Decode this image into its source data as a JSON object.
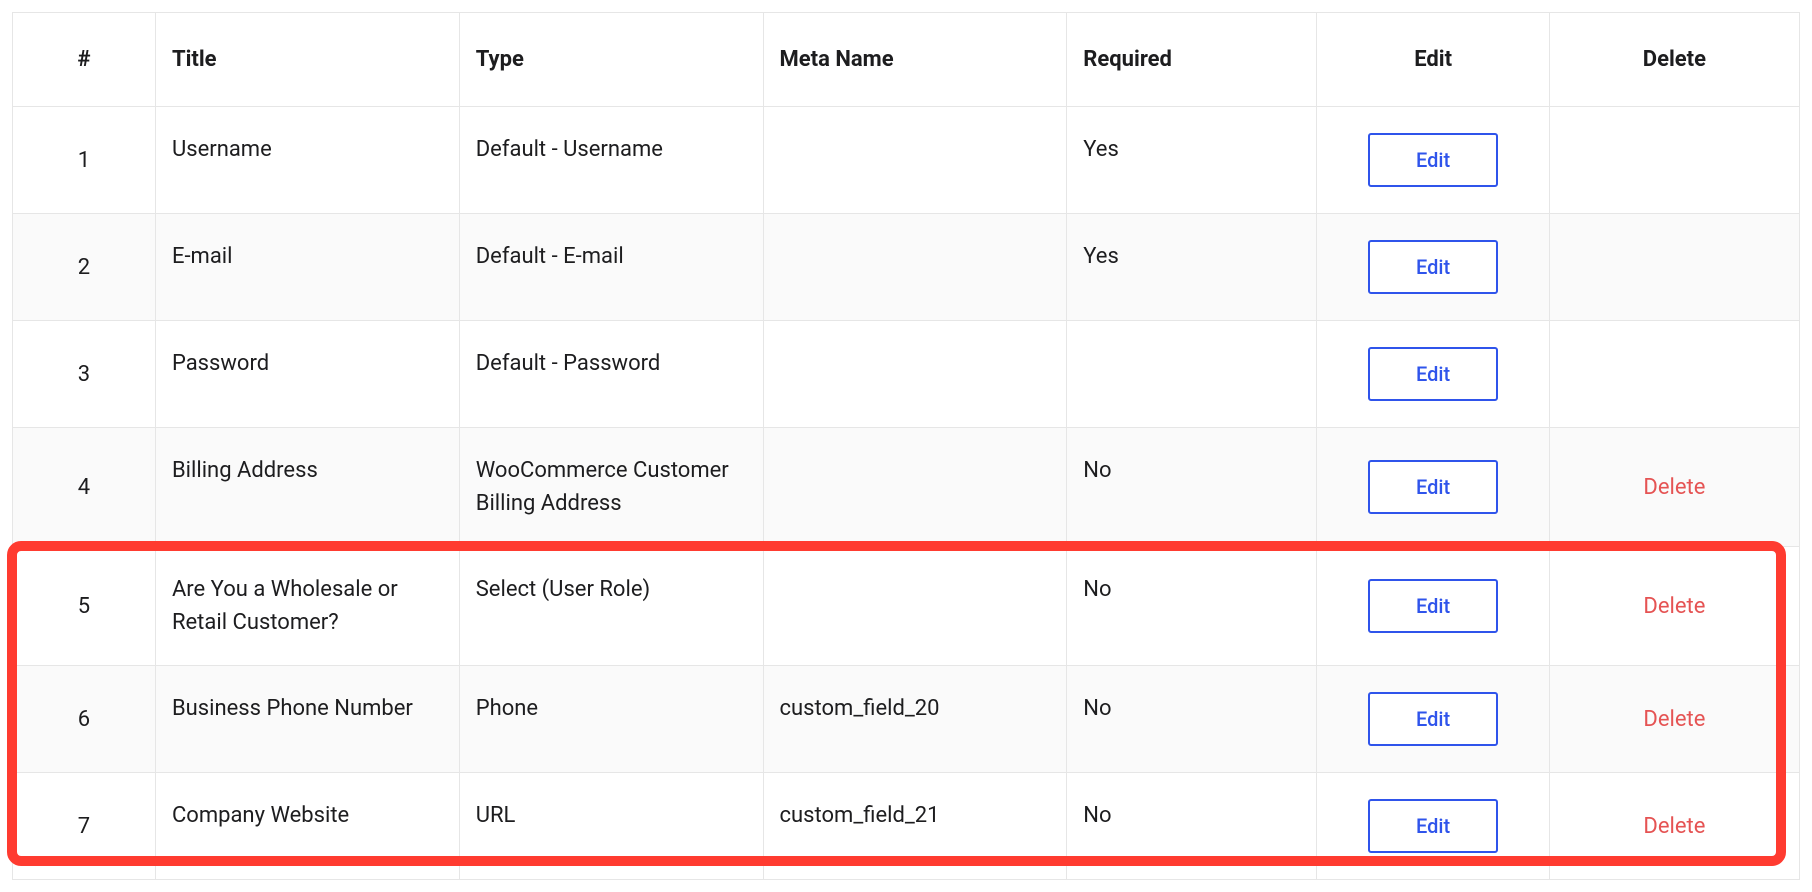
{
  "table": {
    "headers": {
      "num": "#",
      "title": "Title",
      "type": "Type",
      "meta": "Meta Name",
      "required": "Required",
      "edit": "Edit",
      "delete": "Delete"
    },
    "edit_label": "Edit",
    "delete_label": "Delete",
    "rows": [
      {
        "num": "1",
        "title": "Username",
        "type": "Default - Username",
        "meta": "",
        "required": "Yes",
        "deletable": false
      },
      {
        "num": "2",
        "title": "E-mail",
        "type": "Default - E-mail",
        "meta": "",
        "required": "Yes",
        "deletable": false
      },
      {
        "num": "3",
        "title": "Password",
        "type": "Default - Password",
        "meta": "",
        "required": "",
        "deletable": false
      },
      {
        "num": "4",
        "title": "Billing Address",
        "type": "WooCommerce Customer Billing Address",
        "meta": "",
        "required": "No",
        "deletable": true
      },
      {
        "num": "5",
        "title": "Are You a Wholesale or Retail Customer?",
        "type": "Select (User Role)",
        "meta": "",
        "required": "No",
        "deletable": true
      },
      {
        "num": "6",
        "title": "Business Phone Number",
        "type": "Phone",
        "meta": "custom_field_20",
        "required": "No",
        "deletable": true
      },
      {
        "num": "7",
        "title": "Company Website",
        "type": "URL",
        "meta": "custom_field_21",
        "required": "No",
        "deletable": true
      }
    ],
    "highlight_row_indices": [
      4,
      5,
      6
    ]
  }
}
